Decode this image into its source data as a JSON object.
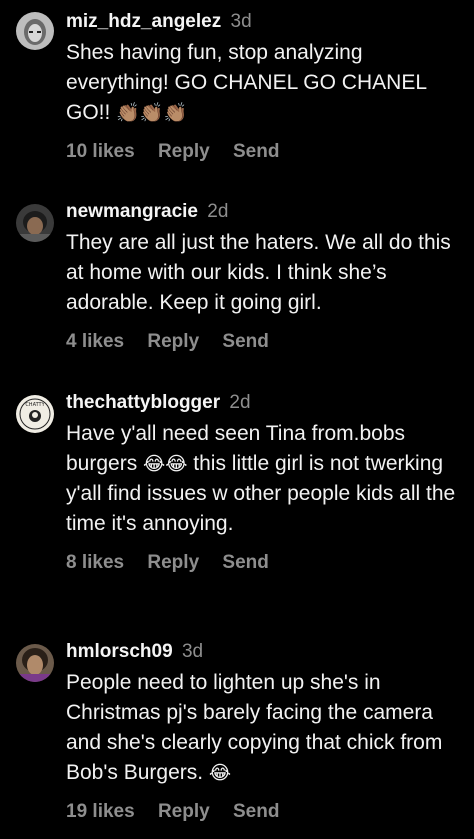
{
  "comments": [
    {
      "username": "miz_hdz_angelez",
      "time": "3d",
      "text": "Shes having fun, stop analyzing everything! GO CHANEL GO CHANEL GO!!",
      "emoji": "👏🏽👏🏽👏🏽",
      "likes": "10 likes",
      "reply": "Reply",
      "send": "Send",
      "avatar_icon": "avatar-grayscale-face"
    },
    {
      "username": "newmangracie",
      "time": "2d",
      "text": "They are all just the haters. We all do this at home with our kids. I think she’s adorable. Keep it going girl.",
      "emoji": "",
      "likes": "4 likes",
      "reply": "Reply",
      "send": "Send",
      "avatar_icon": "avatar-face"
    },
    {
      "username": "thechattyblogger",
      "time": "2d",
      "text_part1": "Have y'all need seen Tina from.bobs burgers",
      "emoji": "😂😂",
      "text_part2": "this little girl is not twerking y'all find issues w other people kids all the time it's annoying.",
      "likes": "8 likes",
      "reply": "Reply",
      "send": "Send",
      "avatar_icon": "avatar-logo-badge"
    },
    {
      "username": "hmlorsch09",
      "time": "3d",
      "text": "People need to lighten up she's in Christmas pj's barely facing the camera and she's clearly copying that chick from Bob's Burgers.",
      "emoji": "😂",
      "likes": "19 likes",
      "reply": "Reply",
      "send": "Send",
      "avatar_icon": "avatar-face"
    }
  ],
  "colors": {
    "background": "#000000",
    "text": "#f2f2f2",
    "muted": "#8e8e8e"
  }
}
